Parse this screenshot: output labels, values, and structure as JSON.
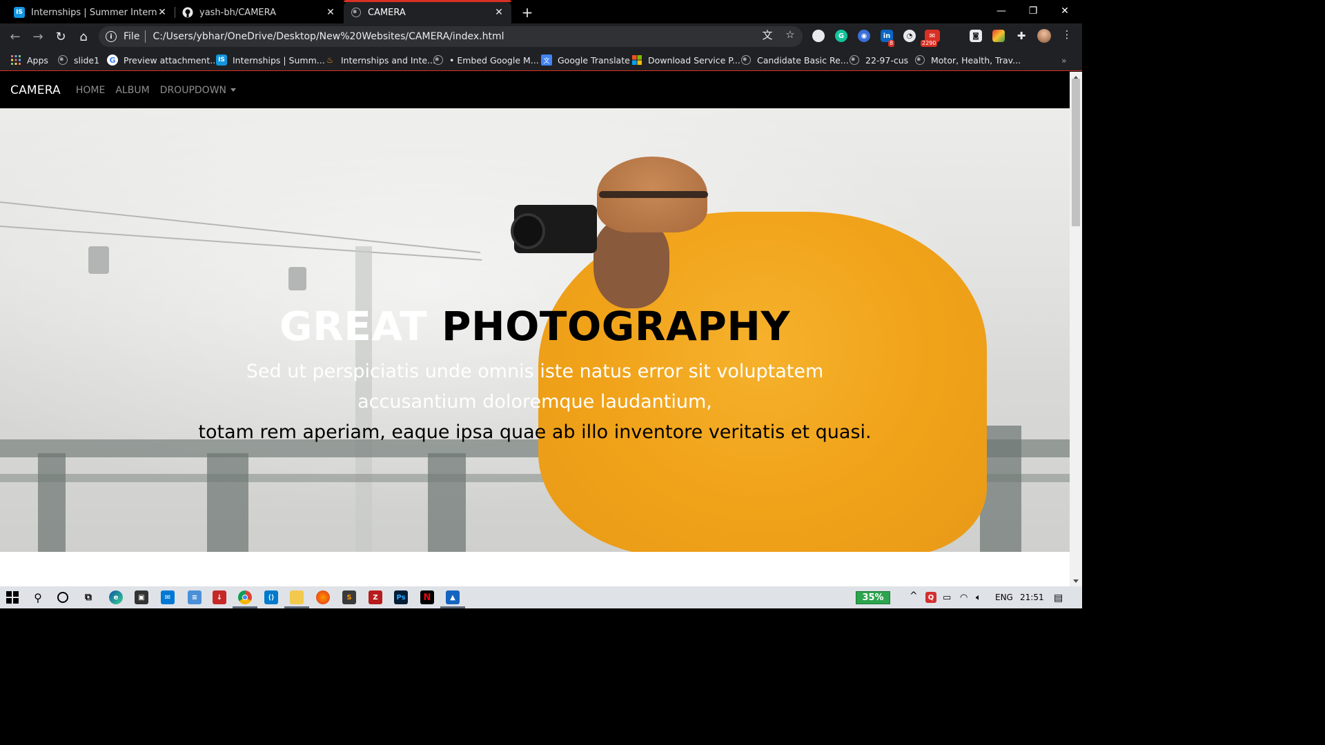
{
  "browser": {
    "tabs": [
      {
        "title": "Internships | Summer Internship",
        "favicon": "IS",
        "active": false
      },
      {
        "title": "yash-bh/CAMERA",
        "favicon": "github-icon",
        "active": false
      },
      {
        "title": "CAMERA",
        "favicon": "globe-icon",
        "active": true
      }
    ],
    "address": {
      "scheme_label": "File",
      "url": "C:/Users/ybhar/OneDrive/Desktop/New%20Websites/CAMERA/index.html"
    },
    "extensions": {
      "linkedin_badge": "8",
      "mail_badge": "2290"
    },
    "bookmarks": [
      {
        "label": "Apps",
        "icon": "apps-grid-icon"
      },
      {
        "label": "slide1",
        "icon": "globe-icon"
      },
      {
        "label": "Preview attachment...",
        "icon": "google-icon"
      },
      {
        "label": "Internships | Summ...",
        "icon": "internshala-icon"
      },
      {
        "label": "Internships and Inte...",
        "icon": "flame-icon"
      },
      {
        "label": "• Embed Google M...",
        "icon": "globe-icon"
      },
      {
        "label": "Google Translate",
        "icon": "translate-icon"
      },
      {
        "label": "Download Service P...",
        "icon": "microsoft-icon"
      },
      {
        "label": "Candidate Basic Re...",
        "icon": "globe-icon"
      },
      {
        "label": "22-97-cus",
        "icon": "globe-icon"
      },
      {
        "label": "Motor, Health, Trav...",
        "icon": "globe-icon"
      }
    ]
  },
  "site": {
    "brand": "CAMERA",
    "nav": [
      {
        "label": "HOME"
      },
      {
        "label": "ALBUM"
      },
      {
        "label": "DROUPDOWN"
      }
    ],
    "hero": {
      "title_word1": "GREAT",
      "title_word2": "PHOTOGRAPHY",
      "subtitle_line1": "Sed ut perspiciatis unde omnis iste natus error sit voluptatem accusantium doloremque laudantium,",
      "subtitle_line2": "totam rem aperiam, eaque ipsa quae ab illo inventore veritatis et quasi."
    }
  },
  "taskbar": {
    "battery": "35%",
    "language": "ENG",
    "time": "21:51"
  },
  "colors": {
    "accent_red": "#d93025",
    "coat_orange": "#f0a219",
    "chrome_dark": "#202124"
  }
}
